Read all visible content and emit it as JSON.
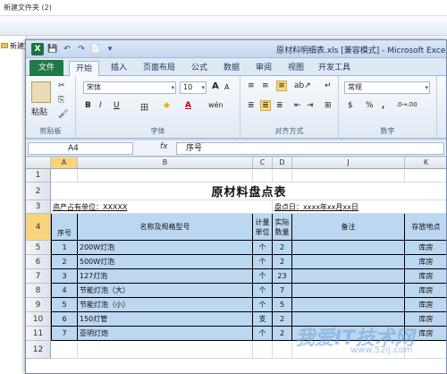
{
  "explorer": {
    "path": "新建文件夹 (2)",
    "left_label": "新建文件"
  },
  "window": {
    "title": "原材料明细表.xls [兼容模式] - Microsoft Excel",
    "app_letter": "X",
    "qat": [
      "💾",
      "↶",
      "↷",
      "📄",
      "▾"
    ]
  },
  "ribbon": {
    "tabs": [
      "文件",
      "开始",
      "插入",
      "页面布局",
      "公式",
      "数据",
      "审阅",
      "视图",
      "开发工具"
    ],
    "active_tab": "开始",
    "clipboard": {
      "paste_label": "粘贴",
      "group_label": "剪贴板"
    },
    "font": {
      "name": "宋体",
      "size": "10",
      "grow": "A",
      "shrink": "A",
      "bold": "B",
      "italic": "I",
      "underline": "U",
      "borders": "田",
      "fill": "◆",
      "font_color": "A",
      "phonetic": "wén",
      "group_label": "字体"
    },
    "alignment": {
      "group_label": "对齐方式"
    },
    "number": {
      "format": "常规",
      "currency": "$",
      "percent": "%",
      "comma": ",",
      "group_label": "数字"
    }
  },
  "formula_bar": {
    "name_box": "A4",
    "fx": "fx",
    "content": "序号"
  },
  "sheet": {
    "columns": [
      "A",
      "B",
      "C",
      "D",
      "J",
      "K"
    ],
    "rows": [
      "1",
      "2",
      "3",
      "4",
      "5",
      "6",
      "7",
      "8",
      "9",
      "10",
      "11",
      "12"
    ],
    "title": "原材料盘点表",
    "unit_label": "资产占有单位：XXXXX",
    "date_label": "盘点日：xxxx年xx月xx日",
    "headers": {
      "seq": "序号",
      "name": "名称及规格型号",
      "unit": "计量\n单位",
      "qty": "实际\n数量",
      "note": "备注",
      "location": "存放地点"
    },
    "items": [
      {
        "seq": "1",
        "name": "200W灯泡",
        "unit": "个",
        "qty": "2",
        "note": "",
        "location": "库房"
      },
      {
        "seq": "2",
        "name": "500W灯泡",
        "unit": "个",
        "qty": "2",
        "note": "",
        "location": "库房"
      },
      {
        "seq": "3",
        "name": "127灯泡",
        "unit": "个",
        "qty": "23",
        "note": "",
        "location": "库房"
      },
      {
        "seq": "4",
        "name": "节能灯泡（大）",
        "unit": "个",
        "qty": "7",
        "note": "",
        "location": "库房"
      },
      {
        "seq": "5",
        "name": "节能灯泡（小）",
        "unit": "个",
        "qty": "5",
        "note": "",
        "location": "库房"
      },
      {
        "seq": "6",
        "name": "150灯管",
        "unit": "支",
        "qty": "2",
        "note": "",
        "location": "库房"
      },
      {
        "seq": "7",
        "name": "亚明灯炮",
        "unit": "个",
        "qty": "2",
        "note": "",
        "location": "库房"
      }
    ]
  },
  "watermark": {
    "text": "我爱IT技术网",
    "url": "www.52ij.com"
  },
  "colors": {
    "file_tab": "#1f7a45",
    "table_fill": "#bcd8f1",
    "header_highlight": "#f8d47b"
  }
}
